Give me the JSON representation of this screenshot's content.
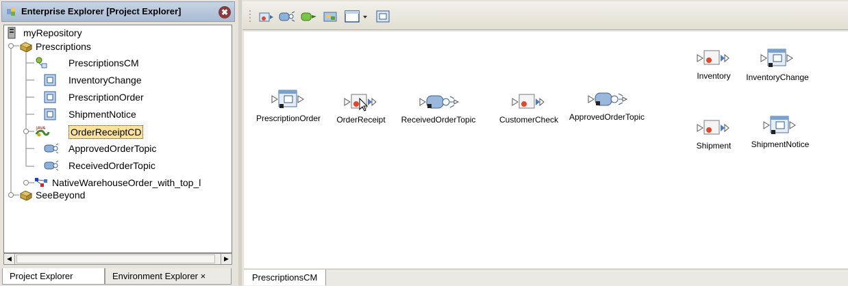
{
  "left_panel": {
    "title": "Enterprise Explorer [Project Explorer]",
    "close_glyph": "✖",
    "tree": [
      {
        "label": "myRepository",
        "icon": "repository-icon"
      },
      {
        "label": "Prescriptions",
        "icon": "project-icon"
      },
      {
        "label": "PrescriptionsCM",
        "icon": "connectivity-map-icon"
      },
      {
        "label": "InventoryChange",
        "icon": "otd-icon"
      },
      {
        "label": "PrescriptionOrder",
        "icon": "otd-icon"
      },
      {
        "label": "ShipmentNotice",
        "icon": "otd-icon"
      },
      {
        "label": "OrderReceiptCD",
        "icon": "java-collaboration-icon"
      },
      {
        "label": "ApprovedOrderTopic",
        "icon": "topic-icon"
      },
      {
        "label": "ReceivedOrderTopic",
        "icon": "topic-icon"
      },
      {
        "label": "NativeWarehouseOrder_with_top_l",
        "icon": "deployment-icon"
      },
      {
        "label": "SeeBeyond",
        "icon": "project-icon"
      }
    ],
    "tabs": [
      {
        "label": "Project Explorer"
      },
      {
        "label": "Environment Explorer ×"
      }
    ]
  },
  "toolbar": {
    "buttons": [
      "new-service-icon",
      "new-topic-icon",
      "new-queue-icon",
      "new-webservice-icon",
      "new-otd-dropdown-icon",
      "external-app-icon"
    ]
  },
  "canvas": {
    "components": [
      {
        "label": "PrescriptionOrder",
        "type": "external"
      },
      {
        "label": "OrderReceipt",
        "type": "service"
      },
      {
        "label": "ReceivedOrderTopic",
        "type": "topic"
      },
      {
        "label": "CustomerCheck",
        "type": "service"
      },
      {
        "label": "ApprovedOrderTopic",
        "type": "topic"
      },
      {
        "label": "Inventory",
        "type": "service"
      },
      {
        "label": "InventoryChange",
        "type": "external"
      },
      {
        "label": "Shipment",
        "type": "service"
      },
      {
        "label": "ShipmentNotice",
        "type": "external"
      }
    ]
  },
  "bottom_tab": {
    "label": "PrescriptionsCM"
  },
  "colors": {
    "selection": "#fbe39b",
    "title_bg": "#b6c6dc",
    "chrome": "#e7e3da"
  }
}
